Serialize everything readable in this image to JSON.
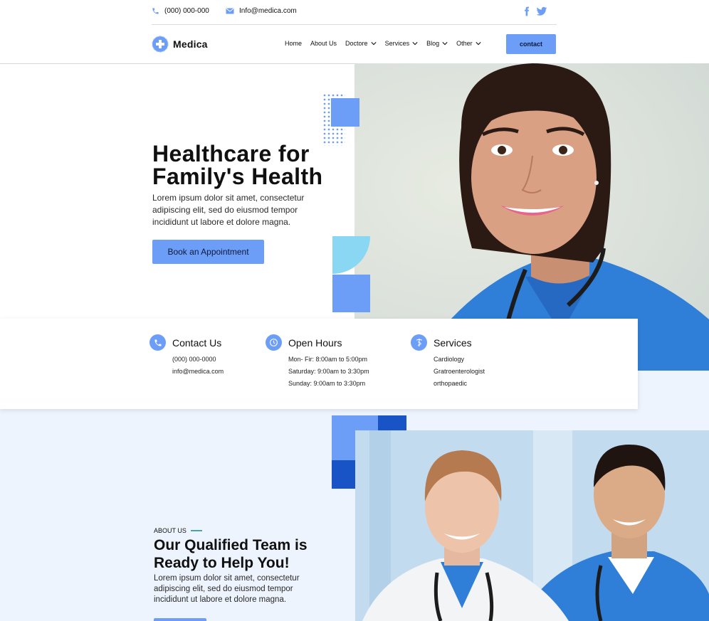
{
  "topbar": {
    "phone": "(000) 000-000",
    "email": "Info@medica.com",
    "social": [
      "facebook-icon",
      "twitter-icon"
    ]
  },
  "brand": {
    "name": "Medica"
  },
  "nav": {
    "items": [
      {
        "label": "Home",
        "dropdown": false
      },
      {
        "label": "About Us",
        "dropdown": false
      },
      {
        "label": "Doctore",
        "dropdown": true
      },
      {
        "label": "Services",
        "dropdown": true
      },
      {
        "label": "Blog",
        "dropdown": true
      },
      {
        "label": "Other",
        "dropdown": true
      }
    ],
    "cta": "contact"
  },
  "hero": {
    "title_line1": "Healthcare for",
    "title_line2": "Family's Health",
    "description": "Lorem ipsum dolor sit amet, consectetur adipiscing elit, sed do eiusmod tempor incididunt ut labore et dolore magna.",
    "button": "Book an Appointment"
  },
  "info": {
    "contact": {
      "title": "Contact Us",
      "lines": [
        "(000) 000-0000",
        "info@medica.com"
      ]
    },
    "hours": {
      "title": "Open Hours",
      "lines": [
        "Mon- Fir: 8:00am to 5:00pm",
        "Saturday: 9:00am to 3:30pm",
        "Sunday: 9:00am to 3:30pm"
      ]
    },
    "services": {
      "title": "Services",
      "lines": [
        "Cardiology",
        "Gratroenterologist",
        "orthopaedic"
      ]
    }
  },
  "about": {
    "label": "ABOUT US",
    "title_line1": "Our Qualified Team is",
    "title_line2": "Ready to Help You!",
    "description": "Lorem ipsum dolor sit amet, consectetur adipiscing elit, sed do eiusmod tempor incididunt ut labore et dolore magna."
  },
  "colors": {
    "accent": "#6d9ef7",
    "accent_dark": "#1854c5",
    "light_cyan": "#8ad7f4",
    "section_bg": "#edf4fe",
    "scrubs": "#2f7fd8"
  }
}
